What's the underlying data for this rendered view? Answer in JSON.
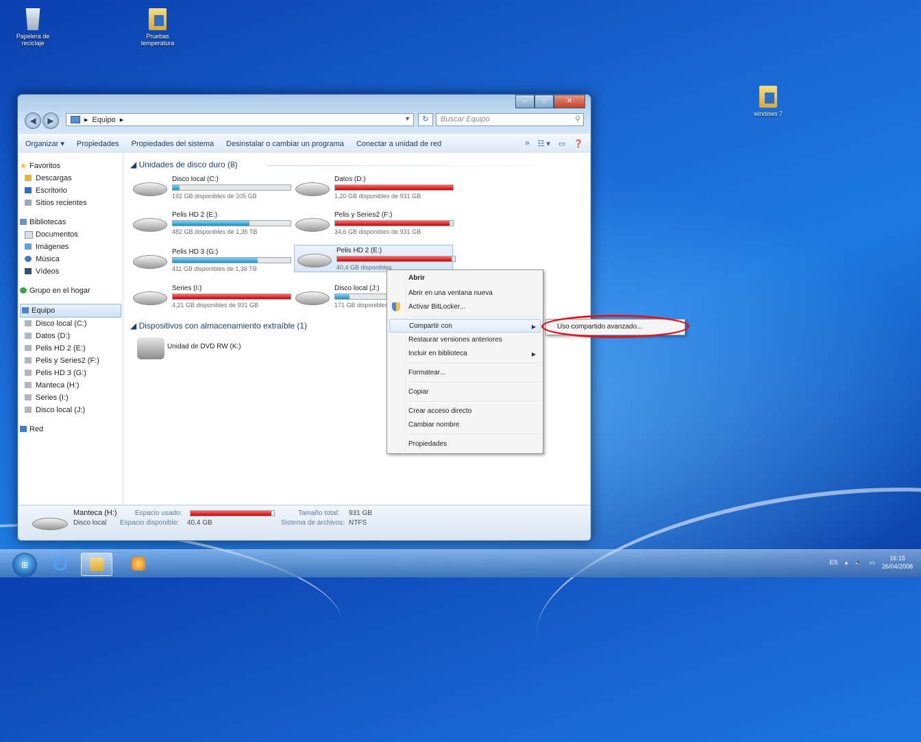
{
  "desktop": {
    "icons": [
      {
        "label": "Papelera de reciclaje"
      },
      {
        "label": "Pruebas temperatura"
      },
      {
        "label": "windows 7"
      }
    ]
  },
  "window": {
    "address": {
      "breadcrumb": "Equipo"
    },
    "search_placeholder": "Buscar Equipo",
    "toolbar": {
      "organize": "Organizar ▾",
      "properties": "Propiedades",
      "system_properties": "Propiedades del sistema",
      "uninstall": "Desinstalar o cambiar un programa",
      "map_drive": "Conectar a unidad de red"
    },
    "nav": {
      "favorites": "Favoritos",
      "downloads": "Descargas",
      "desktop": "Escritorio",
      "recent": "Sitios recientes",
      "libraries": "Bibliotecas",
      "documents": "Documentos",
      "images": "Imágenes",
      "music": "Música",
      "videos": "Vídeos",
      "homegroup": "Grupo en el hogar",
      "computer": "Equipo",
      "drives": [
        "Disco local (C:)",
        "Datos (D:)",
        "Pelis HD 2 (E:)",
        "Pelis y Series2 (F:)",
        "Pelis HD 3 (G:)",
        "Manteca (H:)",
        "Series (I:)",
        "Disco local (J:)"
      ],
      "network": "Red"
    },
    "sections": {
      "hard_drives": "Unidades de disco duro (8)",
      "removable": "Dispositivos con almacenamiento extraíble (1)"
    },
    "drives": [
      {
        "name": "Disco local (C:)",
        "free": "192 GB disponibles de 205 GB",
        "used_fraction": 0.06,
        "color": "#1f8fc6"
      },
      {
        "name": "Datos (D:)",
        "free": "1,20 GB disponibles de 931 GB",
        "used_fraction": 1.0,
        "color": "#d00000"
      },
      {
        "name": "Pelis HD 2 (E:)",
        "free": "482 GB disponibles de 1,36 TB",
        "used_fraction": 0.65,
        "color": "#1f8fc6"
      },
      {
        "name": "Pelis y Series2 (F:)",
        "free": "34,6 GB disponibles de 931 GB",
        "used_fraction": 0.97,
        "color": "#d00000"
      },
      {
        "name": "Pelis HD 3 (G:)",
        "free": "411 GB disponibles de 1,36 TB",
        "used_fraction": 0.72,
        "color": "#1f8fc6"
      },
      {
        "name": "Pelis HD 2 (E:)",
        "free": "40,4 GB disponibles",
        "used_fraction": 0.97,
        "color": "#d00000"
      },
      {
        "name": "Series (I:)",
        "free": "4,21 GB disponibles de 931 GB",
        "used_fraction": 1.0,
        "color": "#d00000"
      },
      {
        "name": "Disco local (J:)",
        "free": "171 GB disponibles",
        "used_fraction": 0.12,
        "color": "#1f8fc6"
      }
    ],
    "dvd": {
      "name": "Unidad de DVD RW (K:)"
    },
    "details": {
      "name": "Manteca (H:)",
      "type": "Disco local",
      "used_label": "Espacio usado:",
      "free_label": "Espacio disponible:",
      "free_value": "40,4 GB",
      "total_label": "Tamaño total:",
      "total_value": "931 GB",
      "fs_label": "Sistema de archivos:",
      "fs_value": "NTFS"
    }
  },
  "context_menu": {
    "items": [
      "Abrir",
      "Abrir en una ventana nueva",
      "Activar BitLocker...",
      "Compartir con",
      "Restaurar versiones anteriores",
      "Incluir en biblioteca",
      "Formatear...",
      "Copiar",
      "Crear acceso directo",
      "Cambiar nombre",
      "Propiedades"
    ]
  },
  "submenu": {
    "item": "Uso compartido avanzado..."
  },
  "taskbar": {
    "language": "ES",
    "time": "16:15",
    "date": "26/04/2008"
  }
}
